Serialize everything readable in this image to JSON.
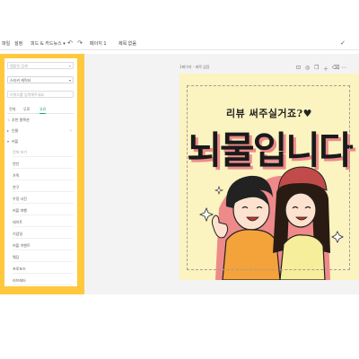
{
  "topbar": {
    "file_label": "파일",
    "edit_label": "설정",
    "size_label": "피드 & 카드뉴스 ▾",
    "doc_title": "제목 없음",
    "page_label": "페이지 1"
  },
  "sidebar": {
    "search_placeholder": "템플릿 검색",
    "select_value": "스티커 캐릭터",
    "keyword_placeholder": "키워드를 입력해주세요",
    "tabs": [
      {
        "label": "전체"
      },
      {
        "label": "무료"
      },
      {
        "label": "유료"
      }
    ],
    "active_tab": "유료",
    "rows": [
      {
        "label": "추천 컬렉션"
      },
      {
        "label": "인물"
      },
      {
        "label": "커플"
      }
    ],
    "sub_items": [
      {
        "label": "전체 보기"
      },
      {
        "label": "연인"
      },
      {
        "label": "가족"
      },
      {
        "label": "친구"
      },
      {
        "label": "우정 사진"
      },
      {
        "label": "커플 여행"
      },
      {
        "label": "데이트"
      },
      {
        "label": "기념일"
      },
      {
        "label": "커플 이벤트"
      },
      {
        "label": "웨딩"
      },
      {
        "label": "프로포즈"
      },
      {
        "label": "러브레터"
      }
    ]
  },
  "canvas": {
    "header": "1페이지 - 제목 없음",
    "artwork": {
      "subtitle": "리뷰 써주실거죠?♥",
      "title": "뇌물입니다"
    }
  },
  "colors": {
    "panel_highlight": "#ffc83d",
    "accent": "#19a974",
    "art_background": "#fbf3c0",
    "title_shadow": "#ee8a8a"
  }
}
